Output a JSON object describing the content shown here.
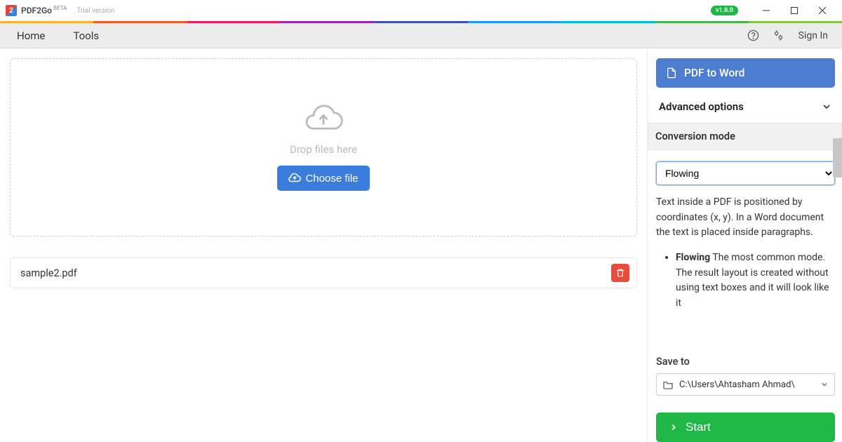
{
  "titlebar": {
    "app_name": "PDF2Go",
    "beta": "BETA",
    "trial": "Trial version",
    "version": "v1.8.0"
  },
  "menubar": {
    "home": "Home",
    "tools": "Tools",
    "signin": "Sign In"
  },
  "dropzone": {
    "text": "Drop files here",
    "choose": "Choose file"
  },
  "file": {
    "name": "sample2.pdf"
  },
  "sidebar": {
    "operation": "PDF to Word",
    "advanced": "Advanced options",
    "mode_title": "Conversion mode",
    "mode_selected": "Flowing",
    "desc_intro": "Text inside a PDF is positioned by coordinates (x, y). In a Word document the text is placed inside paragraphs.",
    "bullet1_strong": "Flowing",
    "bullet1_rest": " The most common mode. The result layout is created without using text boxes and it will look like it",
    "saveto_label": "Save to",
    "saveto_path": "C:\\Users\\Ahtasham Ahmad\\",
    "start": "Start"
  }
}
